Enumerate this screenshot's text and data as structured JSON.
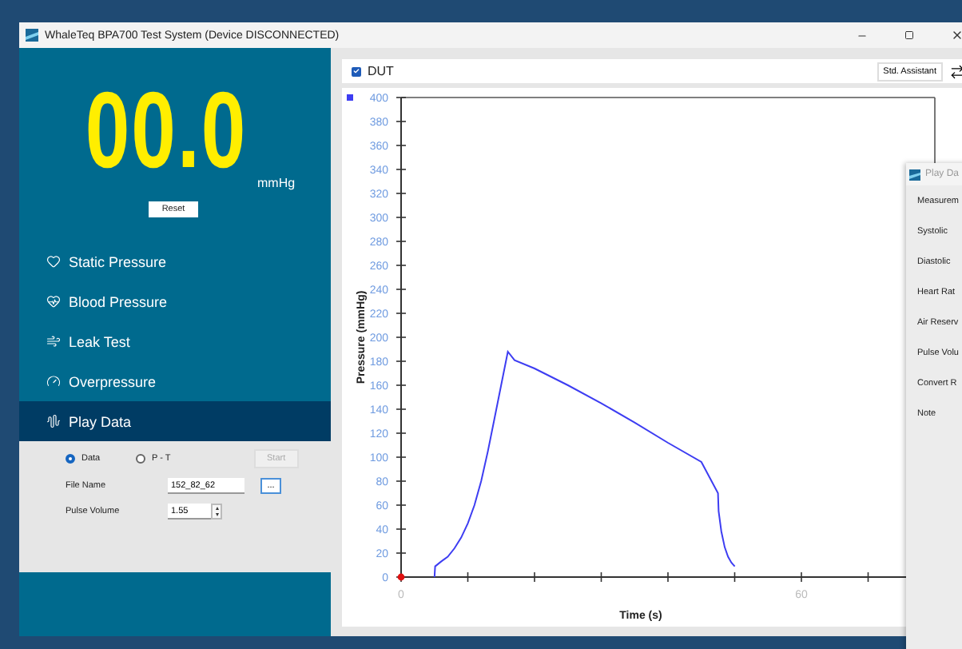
{
  "window": {
    "title": "WhaleTeq BPA700 Test System (Device DISCONNECTED)"
  },
  "display": {
    "value": "00.0",
    "unit": "mmHg",
    "reset": "Reset"
  },
  "nav": [
    {
      "label": "Static Pressure",
      "kind": "static",
      "selected": false
    },
    {
      "label": "Blood Pressure",
      "kind": "blood",
      "selected": false
    },
    {
      "label": "Leak Test",
      "kind": "leak",
      "selected": false
    },
    {
      "label": "Overpressure",
      "kind": "over",
      "selected": false
    },
    {
      "label": "Play Data",
      "kind": "play",
      "selected": true
    }
  ],
  "play_data": {
    "modes": [
      {
        "label": "Data",
        "selected": true
      },
      {
        "label": "P - T",
        "selected": false
      }
    ],
    "start": {
      "label": "Start",
      "disabled": true
    },
    "file_name": {
      "label": "File Name",
      "value": "152_82_62",
      "browse": "..."
    },
    "pulse_volume": {
      "label": "Pulse Volume",
      "value": "1.55"
    }
  },
  "header": {
    "device": {
      "label": "DUT",
      "checked": true
    },
    "assistant": "Std. Assistant"
  },
  "chart": {
    "chart_data": {
      "type": "line",
      "xlabel": "Time (s)",
      "ylabel": "Pressure (mmHg)",
      "xlim": [
        0,
        80
      ],
      "ylim": [
        0,
        400
      ],
      "xticks": [
        0,
        60
      ],
      "yticks": [
        0,
        20,
        40,
        60,
        80,
        100,
        120,
        140,
        160,
        180,
        200,
        220,
        240,
        260,
        280,
        300,
        320,
        340,
        360,
        380,
        400
      ],
      "x": [
        5,
        5.1,
        6,
        7,
        8,
        9,
        10,
        11,
        12,
        13,
        14,
        15,
        16,
        17,
        20,
        25,
        30,
        35,
        40,
        45,
        47.5,
        47.6,
        48,
        48.5,
        49,
        49.5,
        50
      ],
      "series": [
        {
          "color": "#3d3df2",
          "values": [
            0,
            9,
            13,
            17,
            24,
            33,
            45,
            60,
            80,
            105,
            132,
            160,
            188,
            181,
            174,
            160,
            145,
            129,
            112,
            96,
            70,
            55,
            38,
            25,
            17,
            12,
            9
          ]
        }
      ]
    }
  },
  "dialog": {
    "title": "Play Da",
    "fields": [
      "Measurem",
      "Systolic",
      "Diastolic",
      "Heart Rat",
      "Air Reserv",
      "Pulse Volu",
      "Convert R",
      "Note"
    ]
  }
}
